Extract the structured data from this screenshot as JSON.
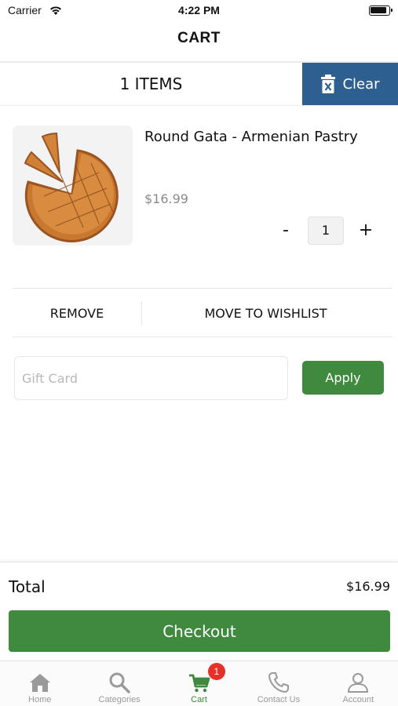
{
  "status_bar": {
    "carrier": "Carrier",
    "time": "4:22 PM"
  },
  "header": {
    "title": "CART"
  },
  "items_bar": {
    "count_label": "1 ITEMS",
    "clear_label": "Clear"
  },
  "cart_item": {
    "name": "Round Gata - Armenian Pastry",
    "price": "$16.99",
    "quantity": "1",
    "minus_label": "-",
    "plus_label": "+"
  },
  "item_actions": {
    "remove_label": "REMOVE",
    "wishlist_label": "MOVE TO WISHLIST"
  },
  "gift_card": {
    "placeholder": "Gift Card",
    "value": "",
    "apply_label": "Apply"
  },
  "summary": {
    "total_label": "Total",
    "total_value": "$16.99",
    "checkout_label": "Checkout"
  },
  "tabbar": {
    "tabs": [
      {
        "label": "Home",
        "icon": "home-icon"
      },
      {
        "label": "Categories",
        "icon": "search-icon"
      },
      {
        "label": "Cart",
        "icon": "cart-icon",
        "badge": "1",
        "active": true
      },
      {
        "label": "Contact Us",
        "icon": "phone-icon"
      },
      {
        "label": "Account",
        "icon": "person-icon"
      }
    ]
  },
  "colors": {
    "primary_green": "#3f8a3f",
    "clear_blue": "#2d5f91",
    "badge_red": "#e6312b"
  }
}
